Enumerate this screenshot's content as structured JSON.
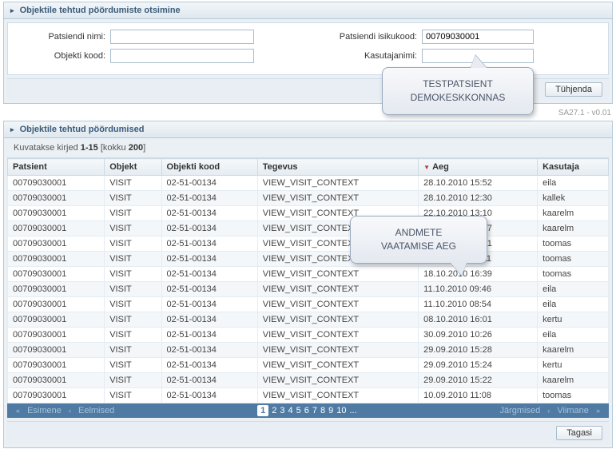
{
  "search_panel": {
    "title": "Objektile tehtud pöördumiste otsimine",
    "patient_name_label": "Patsiendi nimi:",
    "patient_name_value": "",
    "patient_code_label": "Patsiendi isikukood:",
    "patient_code_value": "00709030001",
    "object_code_label": "Objekti kood:",
    "object_code_value": "",
    "username_label": "Kasutajanimi:",
    "username_value": "",
    "clear_button": "Tühjenda"
  },
  "version": "SA27.1 - v0.01",
  "results_panel": {
    "title": "Objektile tehtud pöördumised",
    "records_prefix": "Kuvatakse kirjed ",
    "records_range": "1-15",
    "records_middle": " [kokku ",
    "records_total": "200",
    "records_suffix": "]",
    "columns": {
      "patient": "Patsient",
      "object": "Objekt",
      "object_code": "Objekti kood",
      "activity": "Tegevus",
      "time": "Aeg",
      "user": "Kasutaja"
    },
    "rows": [
      {
        "patient": "00709030001",
        "object": "VISIT",
        "code": "02-51-00134",
        "activity": "VIEW_VISIT_CONTEXT",
        "time": "28.10.2010 15:52",
        "user": "eila"
      },
      {
        "patient": "00709030001",
        "object": "VISIT",
        "code": "02-51-00134",
        "activity": "VIEW_VISIT_CONTEXT",
        "time": "28.10.2010 12:30",
        "user": "kallek"
      },
      {
        "patient": "00709030001",
        "object": "VISIT",
        "code": "02-51-00134",
        "activity": "VIEW_VISIT_CONTEXT",
        "time": "22.10.2010 13:10",
        "user": "kaarelm"
      },
      {
        "patient": "00709030001",
        "object": "VISIT",
        "code": "02-51-00134",
        "activity": "VIEW_VISIT_CONTEXT",
        "time": "22.10.2010 12:57",
        "user": "kaarelm"
      },
      {
        "patient": "00709030001",
        "object": "VISIT",
        "code": "02-51-00134",
        "activity": "VIEW_VISIT_CONTEXT",
        "time": "22.10.2010 09:21",
        "user": "toomas"
      },
      {
        "patient": "00709030001",
        "object": "VISIT",
        "code": "02-51-00134",
        "activity": "VIEW_VISIT_CONTEXT",
        "time": "18.10.2010 17:11",
        "user": "toomas"
      },
      {
        "patient": "00709030001",
        "object": "VISIT",
        "code": "02-51-00134",
        "activity": "VIEW_VISIT_CONTEXT",
        "time": "18.10.2010 16:39",
        "user": "toomas"
      },
      {
        "patient": "00709030001",
        "object": "VISIT",
        "code": "02-51-00134",
        "activity": "VIEW_VISIT_CONTEXT",
        "time": "11.10.2010 09:46",
        "user": "eila"
      },
      {
        "patient": "00709030001",
        "object": "VISIT",
        "code": "02-51-00134",
        "activity": "VIEW_VISIT_CONTEXT",
        "time": "11.10.2010 08:54",
        "user": "eila"
      },
      {
        "patient": "00709030001",
        "object": "VISIT",
        "code": "02-51-00134",
        "activity": "VIEW_VISIT_CONTEXT",
        "time": "08.10.2010 16:01",
        "user": "kertu"
      },
      {
        "patient": "00709030001",
        "object": "VISIT",
        "code": "02-51-00134",
        "activity": "VIEW_VISIT_CONTEXT",
        "time": "30.09.2010 10:26",
        "user": "eila"
      },
      {
        "patient": "00709030001",
        "object": "VISIT",
        "code": "02-51-00134",
        "activity": "VIEW_VISIT_CONTEXT",
        "time": "29.09.2010 15:28",
        "user": "kaarelm"
      },
      {
        "patient": "00709030001",
        "object": "VISIT",
        "code": "02-51-00134",
        "activity": "VIEW_VISIT_CONTEXT",
        "time": "29.09.2010 15:24",
        "user": "kertu"
      },
      {
        "patient": "00709030001",
        "object": "VISIT",
        "code": "02-51-00134",
        "activity": "VIEW_VISIT_CONTEXT",
        "time": "29.09.2010 15:22",
        "user": "kaarelm"
      },
      {
        "patient": "00709030001",
        "object": "VISIT",
        "code": "02-51-00134",
        "activity": "VIEW_VISIT_CONTEXT",
        "time": "10.09.2010 11:08",
        "user": "toomas"
      }
    ]
  },
  "pager": {
    "first": "Esimene",
    "prev": "Eelmised",
    "pages": [
      "1",
      "2",
      "3",
      "4",
      "5",
      "6",
      "7",
      "8",
      "9",
      "10",
      "..."
    ],
    "current": "1",
    "next": "Järgmised",
    "last": "Viimane"
  },
  "back_button": "Tagasi",
  "callouts": {
    "c1_line1": "TESTPATSIENT",
    "c1_line2": "DEMOKESKKONNAS",
    "c2_line1": "ANDMETE",
    "c2_line2": "VAATAMISE AEG"
  }
}
